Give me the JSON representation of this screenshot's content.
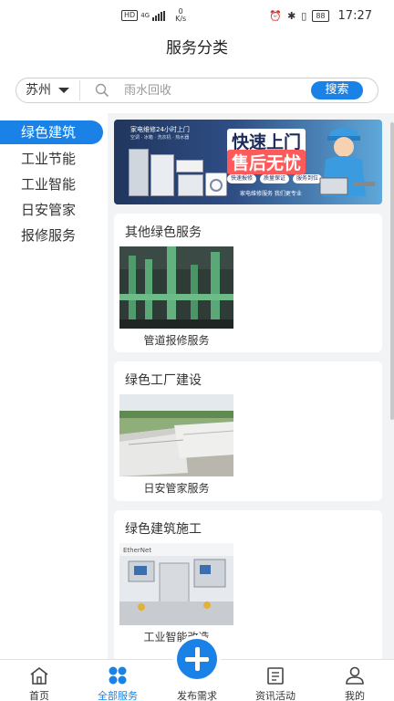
{
  "status_bar": {
    "hd": "HD",
    "network": "4G",
    "speed_value": "0",
    "speed_unit": "K/s",
    "battery": "88",
    "time": "17:27"
  },
  "header": {
    "title": "服务分类"
  },
  "search": {
    "city": "苏州",
    "placeholder": "雨水回收",
    "button": "搜索"
  },
  "sidebar": {
    "items": [
      {
        "label": "绿色建筑",
        "active": true
      },
      {
        "label": "工业节能",
        "active": false
      },
      {
        "label": "工业智能",
        "active": false
      },
      {
        "label": "日安管家",
        "active": false
      },
      {
        "label": "报修服务",
        "active": false
      }
    ]
  },
  "banner": {
    "tag": "家电维修24小时上门",
    "sub": "空调 · 冰箱 · 洗衣机 · 热水器",
    "title_line1": "快速上门",
    "title_line2": "售后无忧",
    "badges": [
      "快速报修",
      "质量保证",
      "服务到位"
    ],
    "footer": "家电维修服务  我们更专业"
  },
  "sections": [
    {
      "title": "其他绿色服务",
      "item": "管道报修服务"
    },
    {
      "title": "绿色工厂建设",
      "item": "日安管家服务"
    },
    {
      "title": "绿色建筑施工",
      "item": "工业智能改造",
      "photo_label": "EtherNet"
    }
  ],
  "tabbar": {
    "items": [
      {
        "label": "首页"
      },
      {
        "label": "全部服务",
        "active": true
      },
      {
        "label": "发布需求"
      },
      {
        "label": "资讯活动"
      },
      {
        "label": "我的"
      }
    ]
  },
  "colors": {
    "accent": "#1a82e6"
  }
}
